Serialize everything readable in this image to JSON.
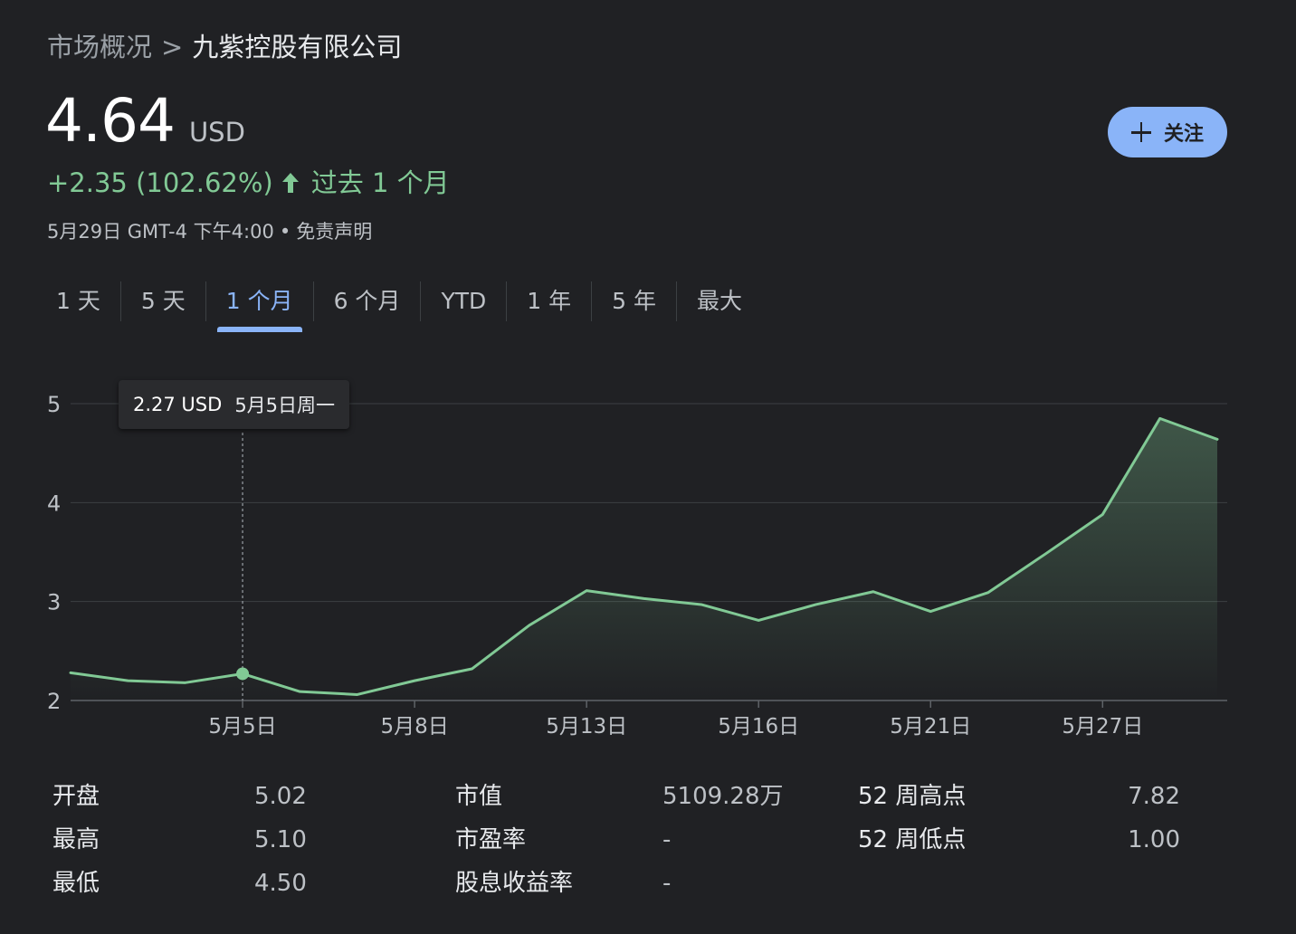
{
  "breadcrumb": {
    "parent": "市场概况",
    "separator": ">",
    "current": "九紫控股有限公司"
  },
  "quote": {
    "price": "4.64",
    "currency": "USD",
    "change": "+2.35 (102.62%)",
    "period": "过去 1 个月",
    "timestamp": "5月29日 GMT-4 下午4:00",
    "bullet": "•",
    "disclaimer": "免责声明"
  },
  "follow_button": {
    "label": "关注"
  },
  "range_tabs": [
    {
      "label": "1 天",
      "active": false
    },
    {
      "label": "5 天",
      "active": false
    },
    {
      "label": "1 个月",
      "active": true
    },
    {
      "label": "6 个月",
      "active": false
    },
    {
      "label": "YTD",
      "active": false
    },
    {
      "label": "1 年",
      "active": false
    },
    {
      "label": "5 年",
      "active": false
    },
    {
      "label": "最大",
      "active": false
    }
  ],
  "tooltip": {
    "price": "2.27 USD",
    "date": "5月5日周一"
  },
  "stats": {
    "columns": [
      [
        {
          "label": "开盘",
          "value": "5.02"
        },
        {
          "label": "最高",
          "value": "5.10"
        },
        {
          "label": "最低",
          "value": "4.50"
        }
      ],
      [
        {
          "label": "市值",
          "value": "5109.28万"
        },
        {
          "label": "市盈率",
          "value": "-"
        },
        {
          "label": "股息收益率",
          "value": "-"
        }
      ],
      [
        {
          "label": "52 周高点",
          "value": "7.82"
        },
        {
          "label": "52 周低点",
          "value": "1.00"
        }
      ]
    ]
  },
  "colors": {
    "background": "#202124",
    "line": "#81c995",
    "accent": "#8ab4f8",
    "gridline": "#3c4043",
    "muted_text": "#bdc1c6"
  },
  "icons": {
    "follow": "plus-icon",
    "trend": "arrow-up-icon"
  },
  "chart_data": {
    "type": "area",
    "x": [
      "5月1日",
      "5月2日",
      "5月2日",
      "5月5日",
      "5月6日",
      "5月7日",
      "5月8日",
      "5月9日",
      "5月12日",
      "5月13日",
      "5月14日",
      "5月15日",
      "5月16日",
      "5月19日",
      "5月20日",
      "5月21日",
      "5月22日",
      "5月23日",
      "5月27日",
      "5月28日",
      "5月29日"
    ],
    "values": [
      2.28,
      2.2,
      2.18,
      2.27,
      2.09,
      2.06,
      2.2,
      2.32,
      2.76,
      3.11,
      3.03,
      2.97,
      2.81,
      2.97,
      3.1,
      2.9,
      3.09,
      3.48,
      3.88,
      4.85,
      4.64
    ],
    "x_tick_labels": [
      "5月5日",
      "5月8日",
      "5月13日",
      "5月16日",
      "5月21日",
      "5月27日"
    ],
    "x_tick_indices": [
      3,
      6,
      9,
      12,
      15,
      18
    ],
    "y_ticks": [
      2,
      3,
      4,
      5
    ],
    "ylim": [
      2,
      5
    ],
    "highlight_index": 3,
    "grid": true
  }
}
